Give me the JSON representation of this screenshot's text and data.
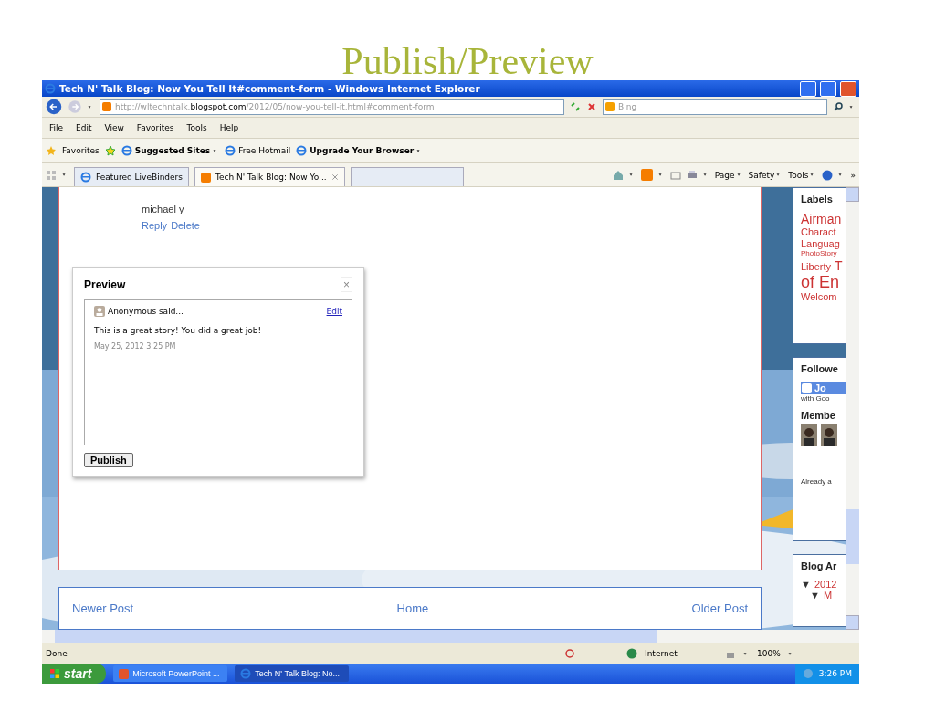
{
  "slide_title": "Publish/Preview",
  "window": {
    "title": "Tech N' Talk Blog: Now You Tell It#comment-form - Windows Internet Explorer"
  },
  "address": {
    "prefix": "http://wltechntalk.",
    "domain": "blogspot.com",
    "path": "/2012/05/now-you-tell-it.html#comment-form"
  },
  "search": {
    "placeholder": "Bing"
  },
  "menu": [
    "File",
    "Edit",
    "View",
    "Favorites",
    "Tools",
    "Help"
  ],
  "favorites_bar": {
    "label": "Favorites",
    "items": [
      {
        "label": "Suggested Sites",
        "bold": true,
        "dropdown": true
      },
      {
        "label": "Free Hotmail",
        "bold": false,
        "dropdown": false
      },
      {
        "label": "Upgrade Your Browser",
        "bold": true,
        "dropdown": true
      }
    ]
  },
  "tabs": [
    {
      "label": "Featured LiveBinders",
      "selected": false,
      "closable": false
    },
    {
      "label": "Tech N' Talk Blog: Now Yo...",
      "selected": true,
      "closable": true
    }
  ],
  "command_bar": [
    "Page",
    "Safety",
    "Tools"
  ],
  "more_glyph": "»",
  "comment": {
    "author": "michael y",
    "links": [
      "Reply",
      "Delete"
    ]
  },
  "preview": {
    "title": "Preview",
    "close_glyph": "×",
    "author": "Anonymous said...",
    "edit_link": "Edit",
    "body": "This is a great story! You did a great job!",
    "timestamp": "May 25, 2012 3:25 PM",
    "button": "Publish"
  },
  "pager": {
    "newer": "Newer Post",
    "home": "Home",
    "older": "Older Post"
  },
  "sidebar": {
    "labels_title": "Labels",
    "labels": [
      {
        "text": "Airman",
        "kind": "large"
      },
      {
        "text": "Charact",
        "kind": "medium"
      },
      {
        "text": "Languag",
        "kind": "medium"
      },
      {
        "text": "PhotoStory",
        "kind": "small"
      },
      {
        "text": "Liberty",
        "kind": "medium"
      },
      {
        "text": "T",
        "kind": "large"
      },
      {
        "text": "of En",
        "kind": "huge"
      },
      {
        "text": "Welcom",
        "kind": "medium"
      }
    ],
    "followers_title": "Followe",
    "join_button": "Jo",
    "join_note": "with Goo",
    "members_title": "Membe",
    "already": "Already a",
    "archive_title": "Blog Ar",
    "archive": [
      {
        "glyph": "▼",
        "text": "2012",
        "expanded": true,
        "children": [
          {
            "glyph": "▼",
            "text": "M",
            "expanded": true
          }
        ]
      }
    ]
  },
  "status_bar": {
    "text": "Done",
    "zone": "Internet",
    "zoom": "100%"
  },
  "taskbar": {
    "start": "start",
    "items": [
      {
        "label": "Microsoft PowerPoint ...",
        "selected": false
      },
      {
        "label": "Tech N' Talk Blog: No...",
        "selected": true
      }
    ],
    "clock": "3:26 PM"
  }
}
